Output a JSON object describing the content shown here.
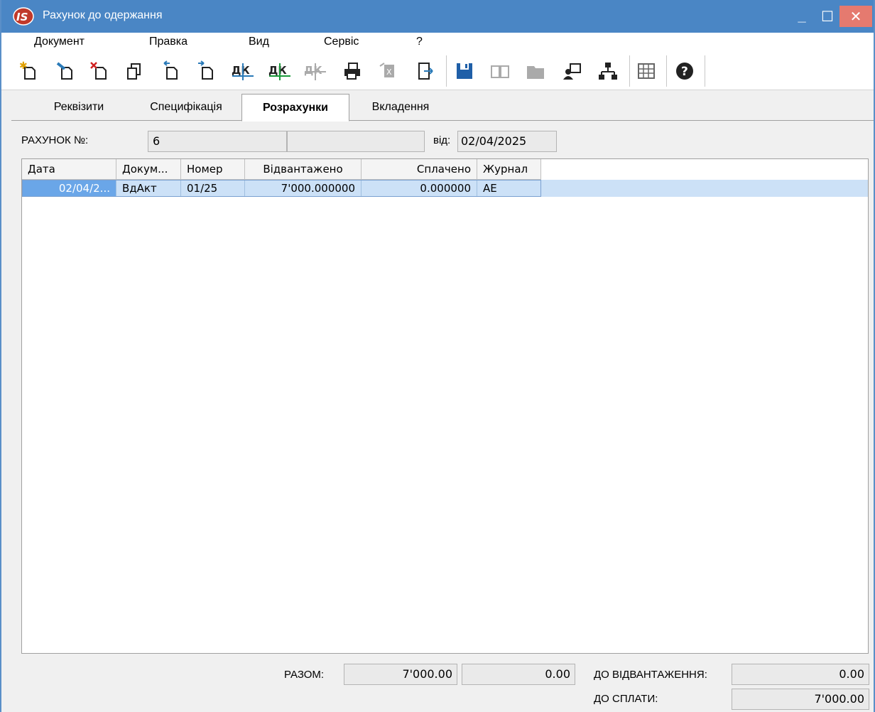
{
  "window": {
    "title": "Рахунок до одержання",
    "min_glyph": "_",
    "max_glyph": "☐",
    "close_glyph": "✕"
  },
  "menu": [
    "Документ",
    "Правка",
    "Вид",
    "Сервіс",
    "?"
  ],
  "toolbar": {
    "icons": [
      "new-document-icon",
      "edit-document-icon",
      "delete-document-icon",
      "copy-document-icon",
      "move-back-icon",
      "move-forward-icon",
      "debit-credit-icon",
      "debit-credit-green-icon",
      "debit-credit-disabled-icon",
      "print-icon",
      "excel-disabled-icon",
      "exit-document-icon",
      "save-icon",
      "open-book-disabled-icon",
      "folder-disabled-icon",
      "user-monitor-icon",
      "structure-tree-icon",
      "table-grid-icon",
      "help-icon"
    ]
  },
  "tabs": [
    "Реквізити",
    "Специфікація",
    "Розрахунки",
    "Вкладення"
  ],
  "active_tab": "Розрахунки",
  "header": {
    "invoice_label": "РАХУНОК №:",
    "invoice_number": "6",
    "invoice_extra": "",
    "date_label": "від:",
    "date_value": "02/04/2025"
  },
  "table": {
    "columns": [
      "Дата",
      "Докум...",
      "Номер",
      "Відвантажено",
      "Сплачено",
      "Журнал"
    ],
    "rows": [
      [
        "02/04/2...",
        "ВдАкт",
        "01/25",
        "7'000.000000",
        "0.000000",
        "АЕ"
      ]
    ]
  },
  "totals": {
    "total_label": "РАЗОМ:",
    "shipped_total": "7'000.00",
    "paid_total": "0.00",
    "to_ship_label": "ДО ВІДВАНТАЖЕННЯ:",
    "to_ship_value": "0.00",
    "to_pay_label": "ДО СПЛАТИ:",
    "to_pay_value": "7'000.00"
  },
  "colors": {
    "titlebar": "#4a86c5",
    "close_button": "#e57a6f",
    "selected_row": "#cce1f7",
    "selected_cell": "#6aa6e8"
  }
}
